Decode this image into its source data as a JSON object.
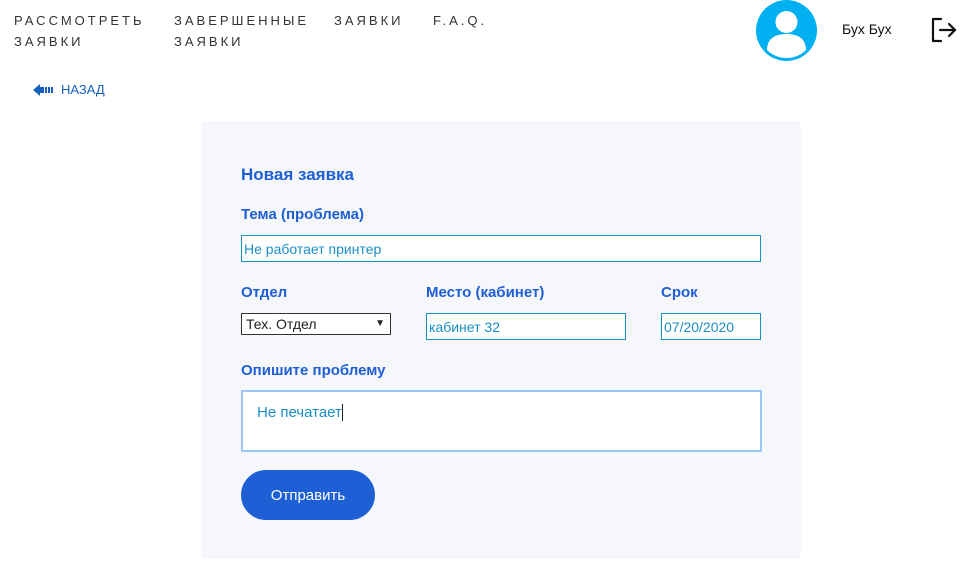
{
  "nav": {
    "items": [
      {
        "label": "Рассмотреть\nзаявки"
      },
      {
        "label": "Завершенные\nзаявки"
      },
      {
        "label": "Заявки"
      },
      {
        "label": "F.A.Q."
      }
    ]
  },
  "user": {
    "name": "Бух Бух"
  },
  "back": {
    "label": "НАЗАД"
  },
  "form": {
    "title": "Новая заявка",
    "topic_label": "Тема (проблема)",
    "topic_value": "Не работает принтер",
    "department_label": "Отдел",
    "department_value": "Тех. Отдел",
    "place_label": "Место (кабинет)",
    "place_value": "кабинет 32",
    "deadline_label": "Срок",
    "deadline_value": "07/20/2020",
    "description_label": "Опишите проблему",
    "description_value": "Не печатает",
    "submit_label": "Отправить"
  },
  "colors": {
    "accent": "#1f5fd6",
    "avatar": "#00b0f0",
    "card_bg": "#f5f7fa",
    "input_text": "#1a8fc6",
    "link": "#1560bd"
  },
  "icons": [
    "user-avatar-icon",
    "logout-icon",
    "back-arrow-icon",
    "dropdown-caret-icon"
  ]
}
